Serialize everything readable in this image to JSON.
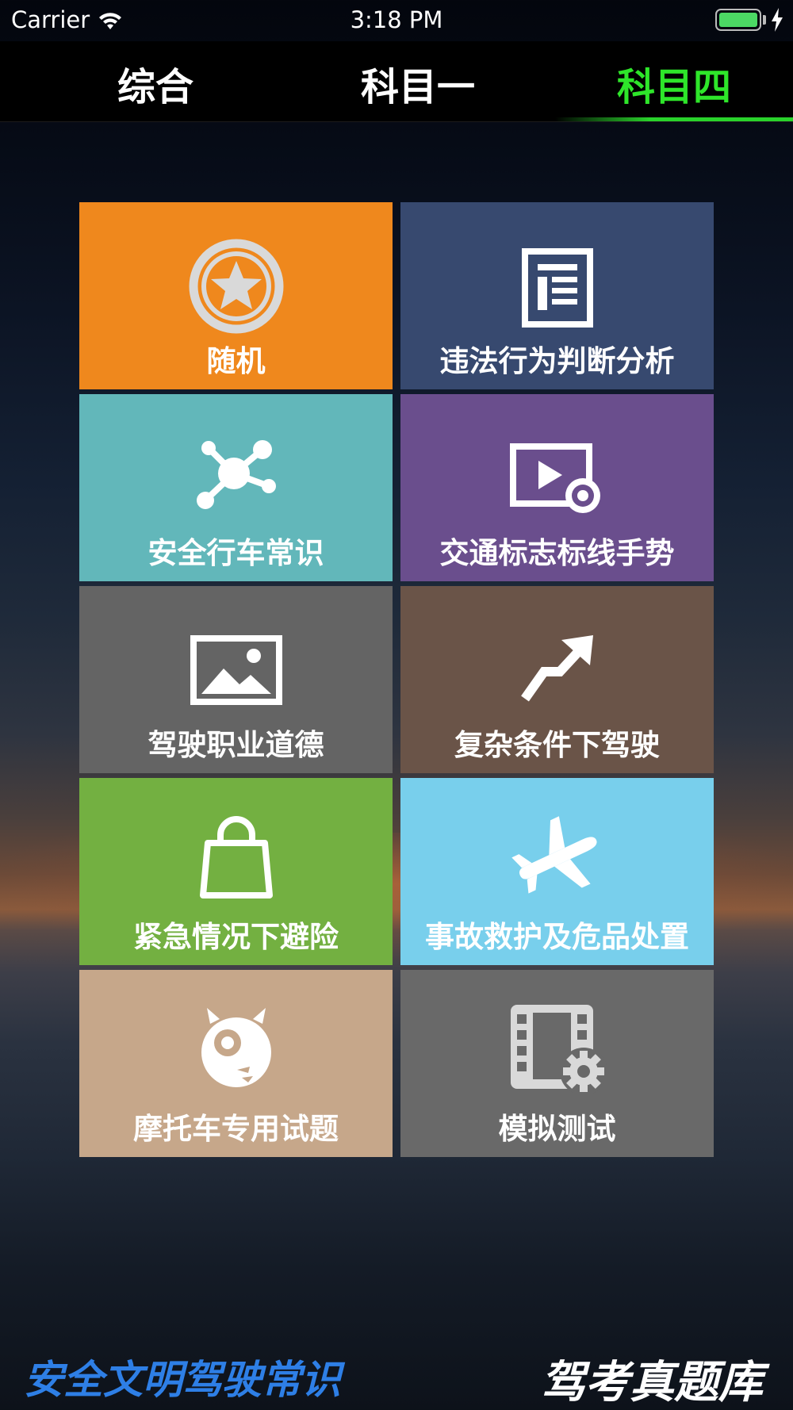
{
  "status_bar": {
    "carrier": "Carrier",
    "time": "3:18 PM"
  },
  "tabs": [
    {
      "label": "综合",
      "active": false
    },
    {
      "label": "科目一",
      "active": false
    },
    {
      "label": "科目四",
      "active": true
    }
  ],
  "colors": {
    "active_tab": "#2ee62a",
    "footer_left": "#2e7fe6"
  },
  "tiles": [
    {
      "label": "随机",
      "color": "#ef881d",
      "icon": "star-circle-icon"
    },
    {
      "label": "违法行为判断分析",
      "color": "#37496f",
      "icon": "document-icon"
    },
    {
      "label": "安全行车常识",
      "color": "#62b7ba",
      "icon": "network-icon"
    },
    {
      "label": "交通标志标线手势",
      "color": "#6a4e8d",
      "icon": "video-icon"
    },
    {
      "label": "驾驶职业道德",
      "color": "#646464",
      "icon": "image-icon"
    },
    {
      "label": "复杂条件下驾驶",
      "color": "#6a5448",
      "icon": "turn-arrow-icon"
    },
    {
      "label": "紧急情况下避险",
      "color": "#73b041",
      "icon": "shopping-bag-icon"
    },
    {
      "label": "事故救护及危品处置",
      "color": "#78cfec",
      "icon": "airplane-icon"
    },
    {
      "label": "摩托车专用试题",
      "color": "#c6a78a",
      "icon": "monster-icon"
    },
    {
      "label": "模拟测试",
      "color": "#696969",
      "icon": "film-gear-icon"
    }
  ],
  "footer": {
    "left": "安全文明驾驶常识",
    "right": "驾考真题库"
  }
}
